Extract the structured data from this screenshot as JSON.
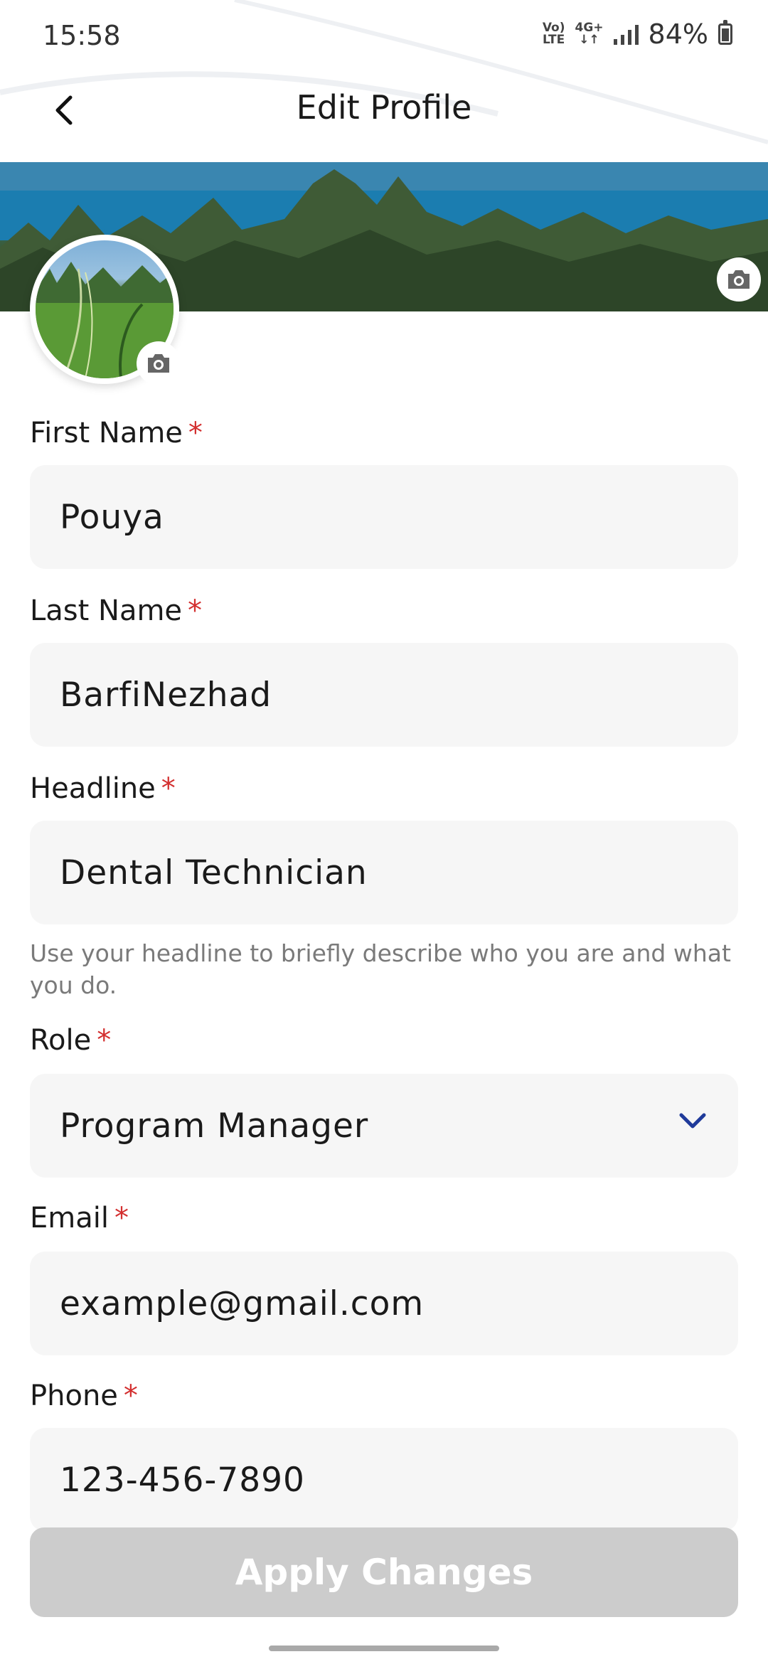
{
  "status_bar": {
    "time": "15:58",
    "network_top": "Vo)",
    "network_bottom": "LTE",
    "data_top": "4G+",
    "battery": "84%"
  },
  "header": {
    "title": "Edit Profile",
    "back_icon": "chevron-left-icon"
  },
  "media": {
    "cover_camera_icon": "camera-icon",
    "avatar_camera_icon": "camera-icon"
  },
  "form": {
    "required_mark": "*",
    "first_name": {
      "label": "First Name",
      "value": "Pouya"
    },
    "last_name": {
      "label": "Last Name",
      "value": "BarfiNezhad"
    },
    "headline": {
      "label": "Headline",
      "value": "Dental Technician",
      "helper": "Use your headline to briefly describe who you are and what you do."
    },
    "role": {
      "label": "Role",
      "value": "Program Manager",
      "icon": "chevron-down-icon"
    },
    "email": {
      "label": "Email",
      "value": "example@gmail.com"
    },
    "phone": {
      "label": "Phone",
      "value": "123-456-7890"
    }
  },
  "actions": {
    "apply_label": "Apply Changes",
    "apply_enabled": false
  },
  "colors": {
    "required": "#d32f2f",
    "field_bg": "#f6f6f6",
    "button_disabled": "#cccccc",
    "chevron": "#1f3a9a"
  }
}
